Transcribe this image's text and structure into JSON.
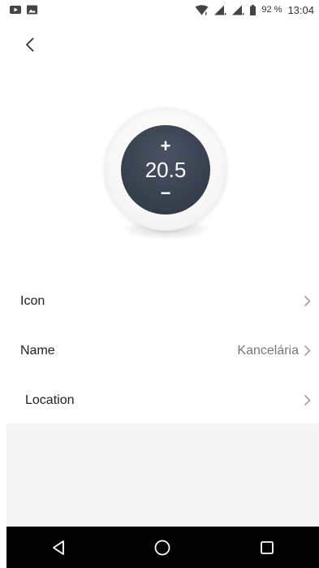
{
  "status_bar": {
    "battery": "92 %",
    "time": "13:04",
    "icons": [
      "youtube-icon",
      "gallery-icon",
      "wifi-icon",
      "signal-icon",
      "signal-icon",
      "battery-icon"
    ]
  },
  "thermostat": {
    "plus": "+",
    "temperature": "20.5",
    "minus": "−"
  },
  "settings": {
    "icon_label": "Icon",
    "name_label": "Name",
    "name_value": "Kanceláriа",
    "location_label": "Location"
  },
  "nav": {
    "buttons": [
      "back-triangle-icon",
      "home-circle-icon",
      "recents-square-icon"
    ]
  }
}
